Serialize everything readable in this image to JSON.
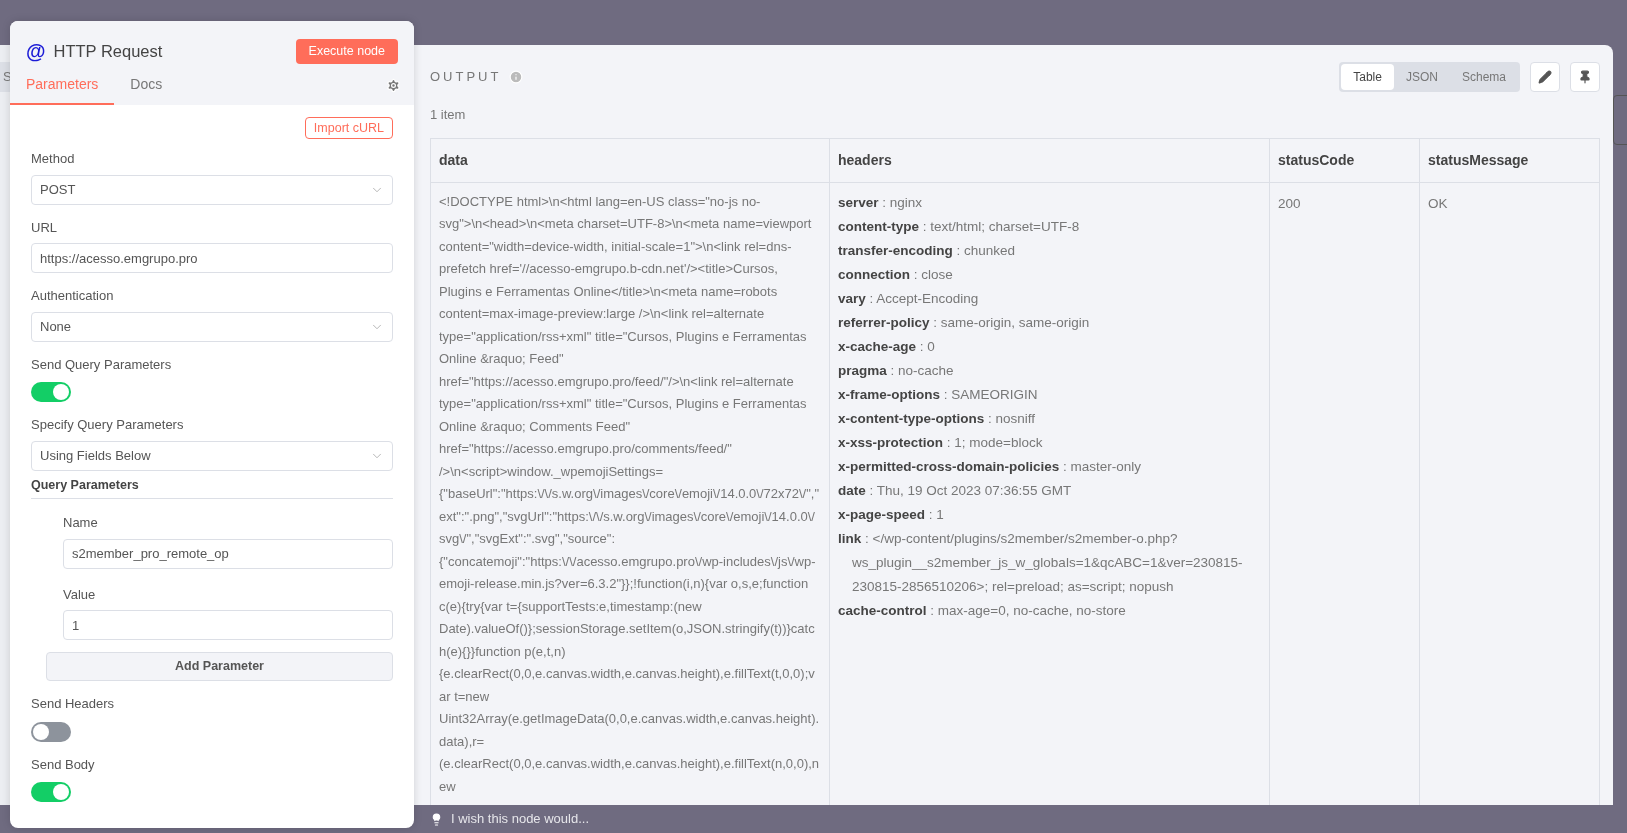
{
  "behind_panel": {
    "cut_label": "S"
  },
  "node_panel": {
    "icon": "@",
    "title": "HTTP Request",
    "execute_button": "Execute node",
    "tabs": [
      {
        "label": "Parameters",
        "selected": true
      },
      {
        "label": "Docs",
        "selected": false
      }
    ],
    "import_button": "Import cURL",
    "fields": [
      {
        "kind": "select",
        "label": "Method",
        "value": "POST"
      },
      {
        "kind": "input",
        "label": "URL",
        "value": "https://acesso.emgrupo.pro"
      },
      {
        "kind": "select",
        "label": "Authentication",
        "value": "None"
      },
      {
        "kind": "toggle",
        "label": "Send Query Parameters",
        "on": true
      },
      {
        "kind": "select",
        "label": "Specify Query Parameters",
        "value": "Using Fields Below"
      },
      {
        "kind": "section",
        "label": "Query Parameters",
        "children": [
          {
            "kind": "input",
            "label": "Name",
            "value": "s2member_pro_remote_op"
          },
          {
            "kind": "input",
            "label": "Value",
            "value": "1"
          }
        ],
        "add_button": "Add Parameter"
      },
      {
        "kind": "toggle",
        "label": "Send Headers",
        "on": false
      },
      {
        "kind": "toggle",
        "label": "Send Body",
        "on": true
      }
    ]
  },
  "output": {
    "title": "OUTPUT",
    "view_tabs": [
      {
        "label": "Table",
        "selected": true
      },
      {
        "label": "JSON",
        "selected": false
      },
      {
        "label": "Schema",
        "selected": false
      }
    ],
    "item_count": "1 item",
    "table": {
      "columns": [
        "data",
        "headers",
        "statusCode",
        "statusMessage"
      ],
      "rows": [
        {
          "data": "<!DOCTYPE html>\\n<html lang=en-US class=\"no-js no-svg\">\\n<head>\\n<meta charset=UTF-8>\\n<meta name=viewport content=\"width=device-width, initial-scale=1\">\\n<link rel=dns-prefetch href='//acesso-emgrupo.b-cdn.net'/><title>Cursos, Plugins e Ferramentas Online</title>\\n<meta name=robots content=max-image-preview:large />\\n<link rel=alternate type=\"application/rss+xml\" title=\"Cursos, Plugins e Ferramentas Online &raquo; Feed\" href=\"https://acesso.emgrupo.pro/feed/\"/>\\n<link rel=alternate type=\"application/rss+xml\" title=\"Cursos, Plugins e Ferramentas Online &raquo; Comments Feed\" href=\"https://acesso.emgrupo.pro/comments/feed/\" />\\n<script>window._wpemojiSettings={\"baseUrl\":\"https:\\/\\/s.w.org\\/images\\/core\\/emoji\\/14.0.0\\/72x72\\/\",\"ext\":\".png\",\"svgUrl\":\"https:\\/\\/s.w.org\\/images\\/core\\/emoji\\/14.0.0\\/svg\\/\",\"svgExt\":\".svg\",\"source\":{\"concatemoji\":\"https:\\/\\/acesso.emgrupo.pro\\/wp-includes\\/js\\/wp-emoji-release.min.js?ver=6.3.2\"}};!function(i,n){var o,s,e;function c(e){try{var t={supportTests:e,timestamp:(new Date).valueOf()};sessionStorage.setItem(o,JSON.stringify(t))}catch(e){}}function p(e,t,n){e.clearRect(0,0,e.canvas.width,e.canvas.height),e.fillText(t,0,0);var t=new Uint32Array(e.getImageData(0,0,e.canvas.width,e.canvas.height).data),r=(e.clearRect(0,0,e.canvas.width,e.canvas.height),e.fillText(n,0,0),new",
          "headers": [
            "**server** : nginx",
            "**content-type** : text/html; charset=UTF-8",
            "**transfer-encoding** : chunked",
            "**connection** : close",
            "**vary** : Accept-Encoding",
            "**referrer-policy** : same-origin, same-origin",
            "**x-cache-age** : 0",
            "**pragma** : no-cache",
            "**x-frame-options** : SAMEORIGIN",
            "**x-content-type-options** : nosniff",
            "**x-xss-protection** : 1; mode=block",
            "**x-permitted-cross-domain-policies** : master-only",
            "**date** : Thu, 19 Oct 2023 07:36:55 GMT",
            "**x-page-speed** : 1",
            "**link** : </wp-content/plugins/s2member/s2member-o.php?ws_plugin__s2member_js_w_globals=1&qcABC=1&ver=230815-230815-2856510206>; rel=preload; as=script; nopush",
            "**cache-control** : max-age=0, no-cache, no-store"
          ],
          "statusCode": "200",
          "statusMessage": "OK"
        }
      ]
    }
  },
  "footer": {
    "text": "I wish this node would..."
  }
}
